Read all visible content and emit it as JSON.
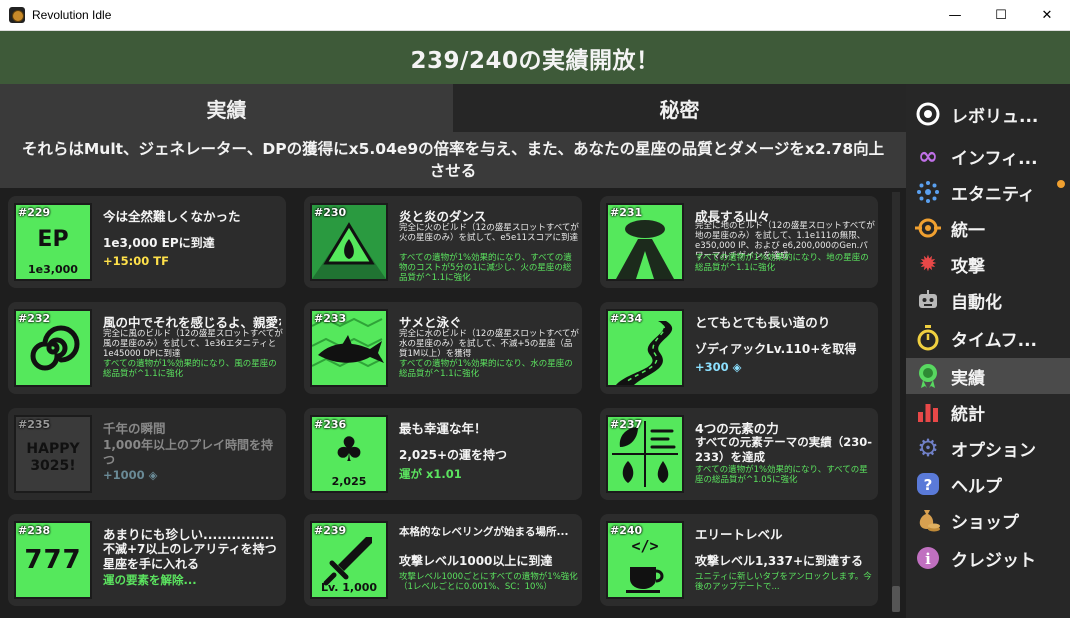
{
  "window": {
    "title": "Revolution Idle",
    "minimize": "—",
    "maximize": "☐",
    "close": "✕"
  },
  "banner": "239/240の実績開放！",
  "tabs": [
    {
      "label": "実績"
    },
    {
      "label": "秘密"
    }
  ],
  "summary": "それらはMult、ジェネレーター、DPの獲得にx5.04e9の倍率を与え、また、あなたの星座の品質とダメージをx2.78向上させる",
  "cards": [
    {
      "num": "#229",
      "title": "今は全然難しくなかった",
      "icon_text": "EP",
      "icon_caption": "1e3,000",
      "desc_big": "1e3,000 EPに到達",
      "reward": "+15:00 TF",
      "icon": "ep-icon"
    },
    {
      "num": "#230",
      "title": "炎と炎のダンス",
      "desc": "完全に火のビルド（12の盛星スロットすべてが火の星座のみ）を試して、e5e11スコアに到達",
      "bonus": "すべての遺物が1%効果的になり、すべての遺物のコストが5分の1に減少し、火の星座の総品質が^1.1に強化",
      "icon": "fire-icon"
    },
    {
      "num": "#231",
      "title": "成長する山々",
      "desc": "完全に地のビルド（12の盛星スロットすべてが地の星座のみ）を試して、1.1e111の無限、e350,000 IP、および e6,200,000のGen.パワーマルチゲインを達成",
      "bonus": "すべての遺物が1%効果的になり、地の星座の総品質が^1.1に強化",
      "icon": "volcano-icon"
    },
    {
      "num": "#232",
      "title": "風の中でそれを感じるよ、親愛なる",
      "desc": "完全に風のビルド（12の盛星スロットすべてが風の星座のみ）を試して、1e36エタニティと1e45000 DPに到達",
      "bonus": "すべての遺物が1%効果的になり、風の星座の総品質が^1.1に強化",
      "icon": "spiral-icon"
    },
    {
      "num": "#233",
      "title": "サメと泳ぐ",
      "desc": "完全に水のビルド（12の盛星スロットすべてが水の星座のみ）を試して、不滅+5の星座（品質1M以上）を獲得",
      "bonus": "すべての遺物が1%効果的になり、水の星座の総品質が^1.1に強化",
      "icon": "shark-icon"
    },
    {
      "num": "#234",
      "title": "とてもとても長い道のり",
      "desc_big": "ゾディアックLv.110+を取得",
      "reward": "+300",
      "icon": "road-icon"
    },
    {
      "num": "#235",
      "title": "千年の瞬間",
      "icon_text": "HAPPY 3025!",
      "desc_big": "1,000年以上のプレイ時間を持つ",
      "reward": "+1000",
      "icon": "happy-icon",
      "locked": true
    },
    {
      "num": "#236",
      "title": "最も幸運な年！",
      "icon_caption": "2,025",
      "desc_big": "2,025+の運を持つ",
      "reward": "運が x1.01",
      "icon": "clover-icon"
    },
    {
      "num": "#237",
      "title": "4つの元素の力",
      "desc_big": "すべての元素テーマの実績（230-233）を達成",
      "bonus": "すべての遺物が1%効果的になり、すべての星座の総品質が^1.05に強化",
      "icon": "elements-icon"
    },
    {
      "num": "#238",
      "title": "あまりにも珍しい...............",
      "icon_text": "777",
      "desc_big": "不滅+7以上のレアリティを持つ星座を手に入れる",
      "reward": "運の要素を解除...",
      "icon": "slot-icon"
    },
    {
      "num": "#239",
      "title": "本格的なレベリングが始まる場所...",
      "icon_caption": "Lv. 1,000",
      "desc_big": "攻撃レベル1000以上に到達",
      "bonus": "攻撃レベル1000ごとにすべての遺物が1%強化（1レベルごとに0.001%、SC：10%）",
      "icon": "sword-icon"
    },
    {
      "num": "#240",
      "title": "エリートレベル",
      "icon_text": "</>",
      "desc_big": "攻撃レベル1,337+に到達する",
      "bonus": "ユニティに新しいタブをアンロックします。今後のアップデートで...",
      "icon": "code-coffee-icon"
    }
  ],
  "sidebar": [
    {
      "label": "レボリュ...",
      "icon": "target-icon",
      "color": "#ffffff"
    },
    {
      "label": "インフィ...",
      "icon": "infinity-icon",
      "color": "#c070e8"
    },
    {
      "label": "エタニティ",
      "icon": "eternity-icon",
      "color": "#5aa0f0",
      "notify": true
    },
    {
      "label": "統一",
      "icon": "unity-icon",
      "color": "#f0a030"
    },
    {
      "label": "攻撃",
      "icon": "attack-icon",
      "color": "#e84848"
    },
    {
      "label": "自動化",
      "icon": "robot-icon",
      "color": "#b8b8b8"
    },
    {
      "label": "タイムフ...",
      "icon": "stopwatch-icon",
      "color": "#f0d040"
    },
    {
      "label": "実績",
      "icon": "medal-icon",
      "color": "#58d860",
      "active": true
    },
    {
      "label": "統計",
      "icon": "chart-icon",
      "color": "#e84848"
    },
    {
      "label": "オプション",
      "icon": "gear-icon",
      "color": "#7080c8"
    },
    {
      "label": "ヘルプ",
      "icon": "help-icon",
      "color": "#5a7ad8"
    },
    {
      "label": "ショップ",
      "icon": "money-bag-icon",
      "color": "#d8a050"
    },
    {
      "label": "クレジット",
      "icon": "info-icon",
      "color": "#c070c0"
    }
  ]
}
